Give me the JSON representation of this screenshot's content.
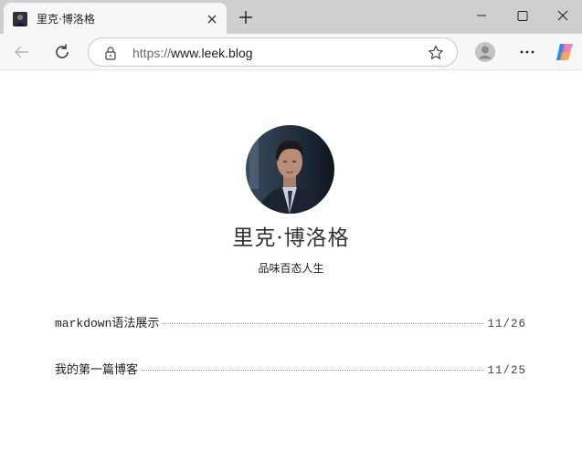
{
  "browser": {
    "tab": {
      "title": "里克·博洛格",
      "favicon": "profile-thumbnail"
    },
    "address_bar": {
      "scheme": "https://",
      "host": "www.leek.blog"
    },
    "icons": [
      "tab-close-icon",
      "new-tab-icon",
      "minimize-icon",
      "maximize-icon",
      "window-close-icon",
      "back-arrow-icon",
      "reload-icon",
      "lock-icon",
      "star-icon",
      "profile-icon",
      "more-icon",
      "copilot-icon"
    ]
  },
  "site": {
    "title": "里克·博洛格",
    "subtitle": "品味百态人生",
    "avatar": "portrait-photo"
  },
  "posts": [
    {
      "title_code": "markdown",
      "title_text": "语法展示",
      "date": "11/26"
    },
    {
      "title_code": "",
      "title_text": "我的第一篇博客",
      "date": "11/25"
    }
  ],
  "colors": {
    "titlebar": "#cfcfcf",
    "toolbar": "#f7f7f7",
    "page_bg": "#ffffff",
    "title_text": "#333333"
  }
}
